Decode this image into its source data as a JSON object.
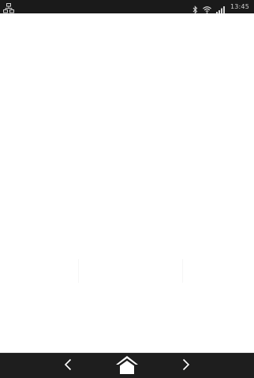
{
  "status_bar": {
    "time": "13:45",
    "left_icon": "network-icon",
    "right_icons": [
      "bluetooth-icon",
      "wifi-icon",
      "signal-icon"
    ],
    "background": "#1a1a1a"
  },
  "nav_bar": {
    "background": "#1e1e1e",
    "buttons": [
      "back-arrow-icon",
      "home-icon",
      "forward-arrow-icon"
    ]
  }
}
